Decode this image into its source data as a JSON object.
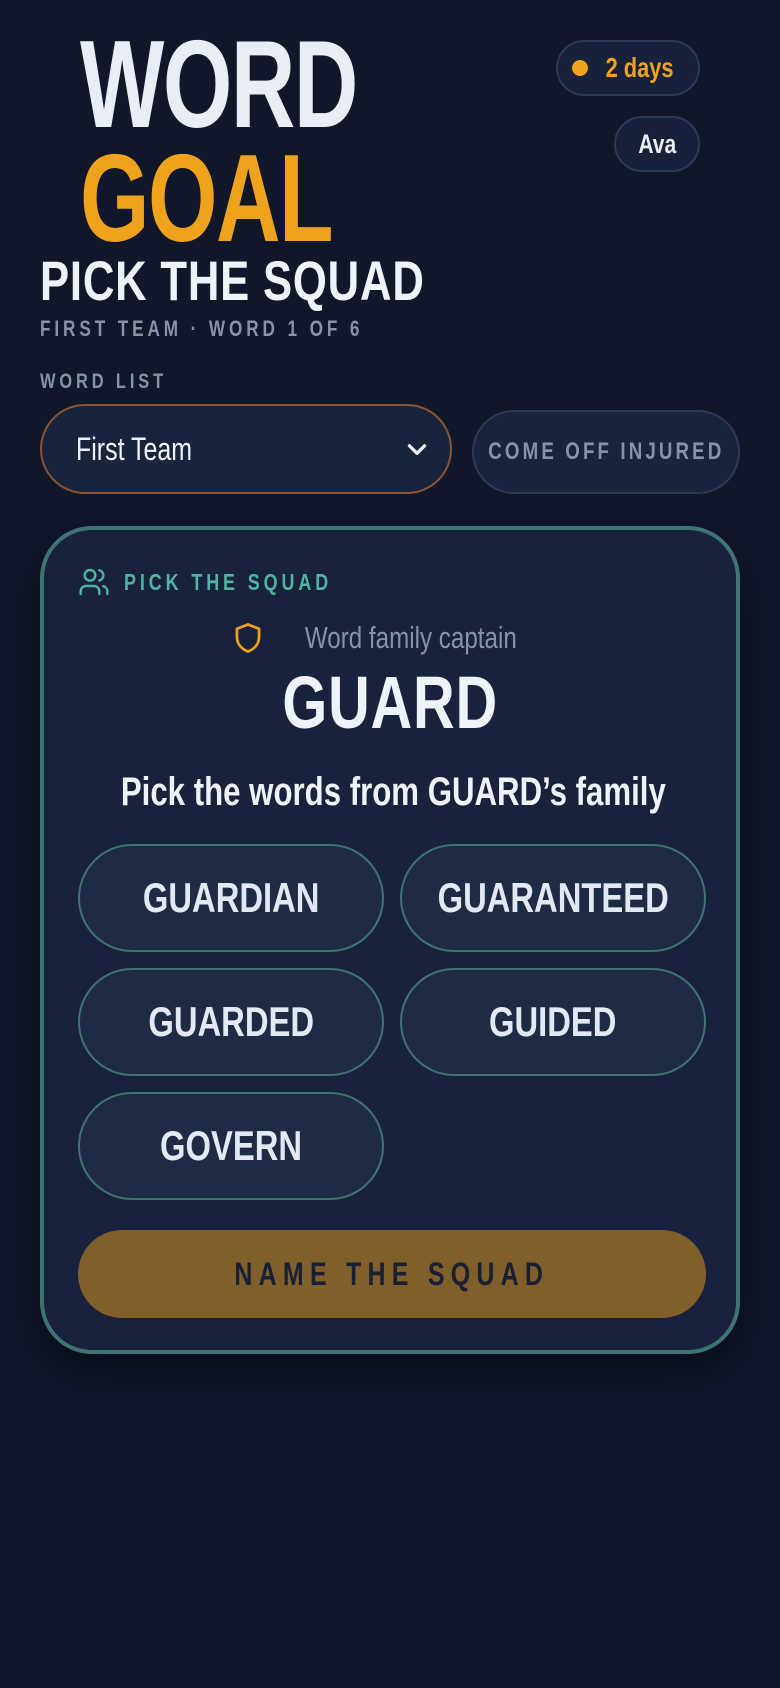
{
  "logo": {
    "line1": "WORD",
    "line2": "GOAL"
  },
  "streak": {
    "label": "2 days"
  },
  "user": {
    "name": "Ava"
  },
  "page": {
    "title": "PICK THE SQUAD",
    "subtitle": "FIRST TEAM · WORD 1 OF 6"
  },
  "word_list": {
    "label": "WORD LIST",
    "selected": "First Team"
  },
  "injury_button": {
    "label": "COME OFF INJURED"
  },
  "card": {
    "header": "PICK THE SQUAD",
    "captain_caption": "Word family captain",
    "captain_word": "GUARD",
    "instruction": "Pick the words from GUARD’s family",
    "options": [
      "GUARDIAN",
      "GUARANTEED",
      "GUARDED",
      "GUIDED",
      "GOVERN"
    ],
    "submit_label": "NAME THE SQUAD"
  },
  "colors": {
    "background": "#0f1729",
    "accent": "#efa21c",
    "teal": "#4fb5a0",
    "card_border": "#3f7474"
  },
  "icons": {
    "streak": "dot-icon",
    "dropdown": "chevron-down-icon",
    "card_header": "users-icon",
    "captain": "shield-icon"
  }
}
